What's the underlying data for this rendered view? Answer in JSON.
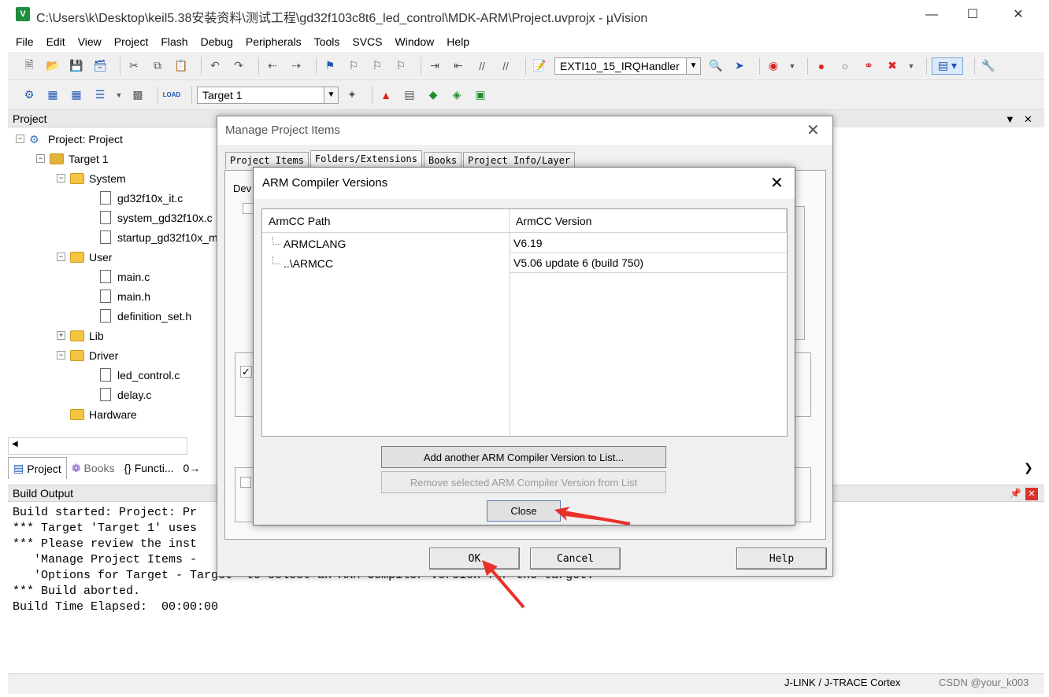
{
  "window": {
    "title": "C:\\Users\\k\\Desktop\\keil5.38安装资料\\测试工程\\gd32f103c8t6_led_control\\MDK-ARM\\Project.uvprojx - µVision",
    "icon_text": "V"
  },
  "menu": [
    "File",
    "Edit",
    "View",
    "Project",
    "Flash",
    "Debug",
    "Peripherals",
    "Tools",
    "SVCS",
    "Window",
    "Help"
  ],
  "toolbar": {
    "function_combo": "EXTI10_15_IRQHandler",
    "target_combo": "Target 1",
    "load_label": "LOAD"
  },
  "project_panel": {
    "title": "Project",
    "tree": [
      {
        "label": "Project: Project",
        "level": 0,
        "kind": "project",
        "expander": "−"
      },
      {
        "label": "Target 1",
        "level": 1,
        "kind": "target",
        "expander": "−"
      },
      {
        "label": "System",
        "level": 2,
        "kind": "folder",
        "expander": "−"
      },
      {
        "label": "gd32f10x_it.c",
        "level": 3,
        "kind": "file"
      },
      {
        "label": "system_gd32f10x.c",
        "level": 3,
        "kind": "file"
      },
      {
        "label": "startup_gd32f10x_m",
        "level": 3,
        "kind": "file"
      },
      {
        "label": "User",
        "level": 2,
        "kind": "folder",
        "expander": "−"
      },
      {
        "label": "main.c",
        "level": 3,
        "kind": "file"
      },
      {
        "label": "main.h",
        "level": 3,
        "kind": "file"
      },
      {
        "label": "definition_set.h",
        "level": 3,
        "kind": "file"
      },
      {
        "label": "Lib",
        "level": 2,
        "kind": "folder",
        "expander": "+"
      },
      {
        "label": "Driver",
        "level": 2,
        "kind": "folder",
        "expander": "−"
      },
      {
        "label": "led_control.c",
        "level": 3,
        "kind": "file"
      },
      {
        "label": "delay.c",
        "level": 3,
        "kind": "file"
      },
      {
        "label": "Hardware",
        "level": 2,
        "kind": "folder"
      }
    ],
    "tabs": [
      "Project",
      "Books",
      "{} Functi...",
      "0→"
    ]
  },
  "build_output": {
    "title": "Build Output",
    "lines": [
      "Build started: Project: Pr",
      "*** Target 'Target 1' uses",
      "*** Please review the inst",
      "   'Manage Project Items -",
      "   'Options for Target - Target' to select an ARM Compiler version for the target.",
      "*** Build aborted.",
      "Build Time Elapsed:  00:00:00"
    ]
  },
  "statusbar": {
    "debugger": "J-LINK / J-TRACE Cortex",
    "watermark": "CSDN @your_k003"
  },
  "manage_dialog": {
    "title": "Manage Project Items",
    "tabs": [
      "Project Items",
      "Folders/Extensions",
      "Books",
      "Project Info/Layer"
    ],
    "active_tab": 1,
    "body_label": "Dev",
    "ok": "OK",
    "cancel": "Cancel",
    "help": "Help"
  },
  "arm_dialog": {
    "title": "ARM Compiler Versions",
    "columns": [
      "ArmCC Path",
      "ArmCC Version"
    ],
    "rows": [
      {
        "path": "ARMCLANG",
        "version": "V6.19"
      },
      {
        "path": "..\\ARMCC",
        "version": "V5.06 update 6 (build 750)"
      }
    ],
    "add_button": "Add another ARM Compiler Version to List...",
    "remove_button": "Remove selected ARM Compiler Version from List",
    "close_button": "Close"
  },
  "annotation_color": "#e8312a"
}
